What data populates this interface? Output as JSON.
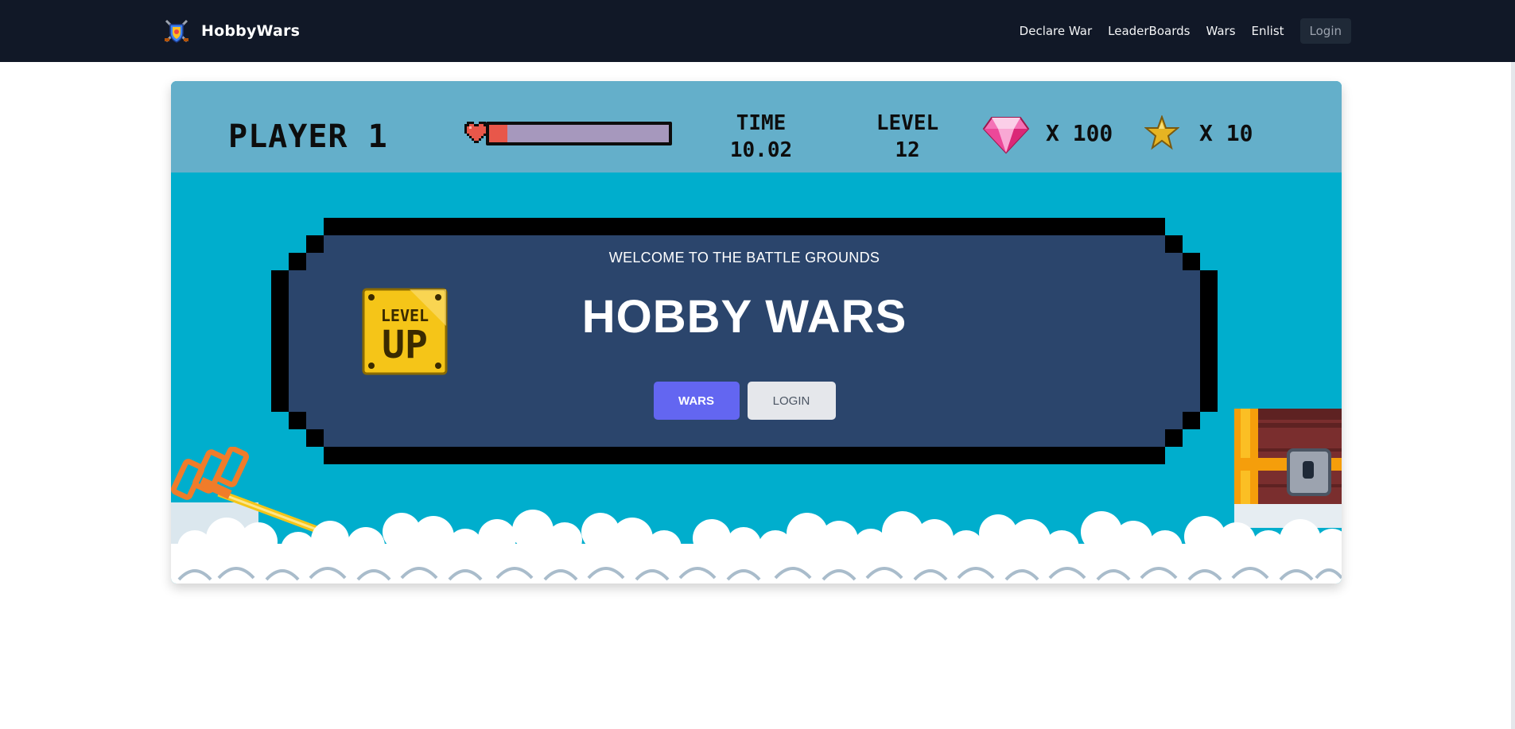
{
  "navbar": {
    "brand_name": "HobbyWars",
    "links": [
      "Declare War",
      "LeaderBoards",
      "Wars",
      "Enlist"
    ],
    "login_label": "Login"
  },
  "hud": {
    "player_label": "PLAYER 1",
    "health_fraction": 0.1,
    "time_label": "TIME",
    "time_value": "10.02",
    "level_label": "LEVEL",
    "level_value": "12",
    "gem_count": "X 100",
    "star_count": "X 10"
  },
  "hero": {
    "subtitle": "WELCOME TO THE BATTLE GROUNDS",
    "title": "HOBBY WARS",
    "badge_line1": "LEVEL",
    "badge_line2": "UP",
    "primary_button": "WARS",
    "secondary_button": "LOGIN"
  },
  "colors": {
    "navbar_bg": "#111827",
    "hud_bg": "#64afca",
    "scene_bg": "#00aecd",
    "panel_bg": "#2b456c",
    "primary_button": "#6366f1",
    "secondary_button": "#e5e7eb"
  },
  "icons": {
    "brand": "crossed-swords-shield-icon",
    "health": "pixel-heart-icon",
    "gem": "pink-diamond-icon",
    "star": "gold-star-icon"
  }
}
